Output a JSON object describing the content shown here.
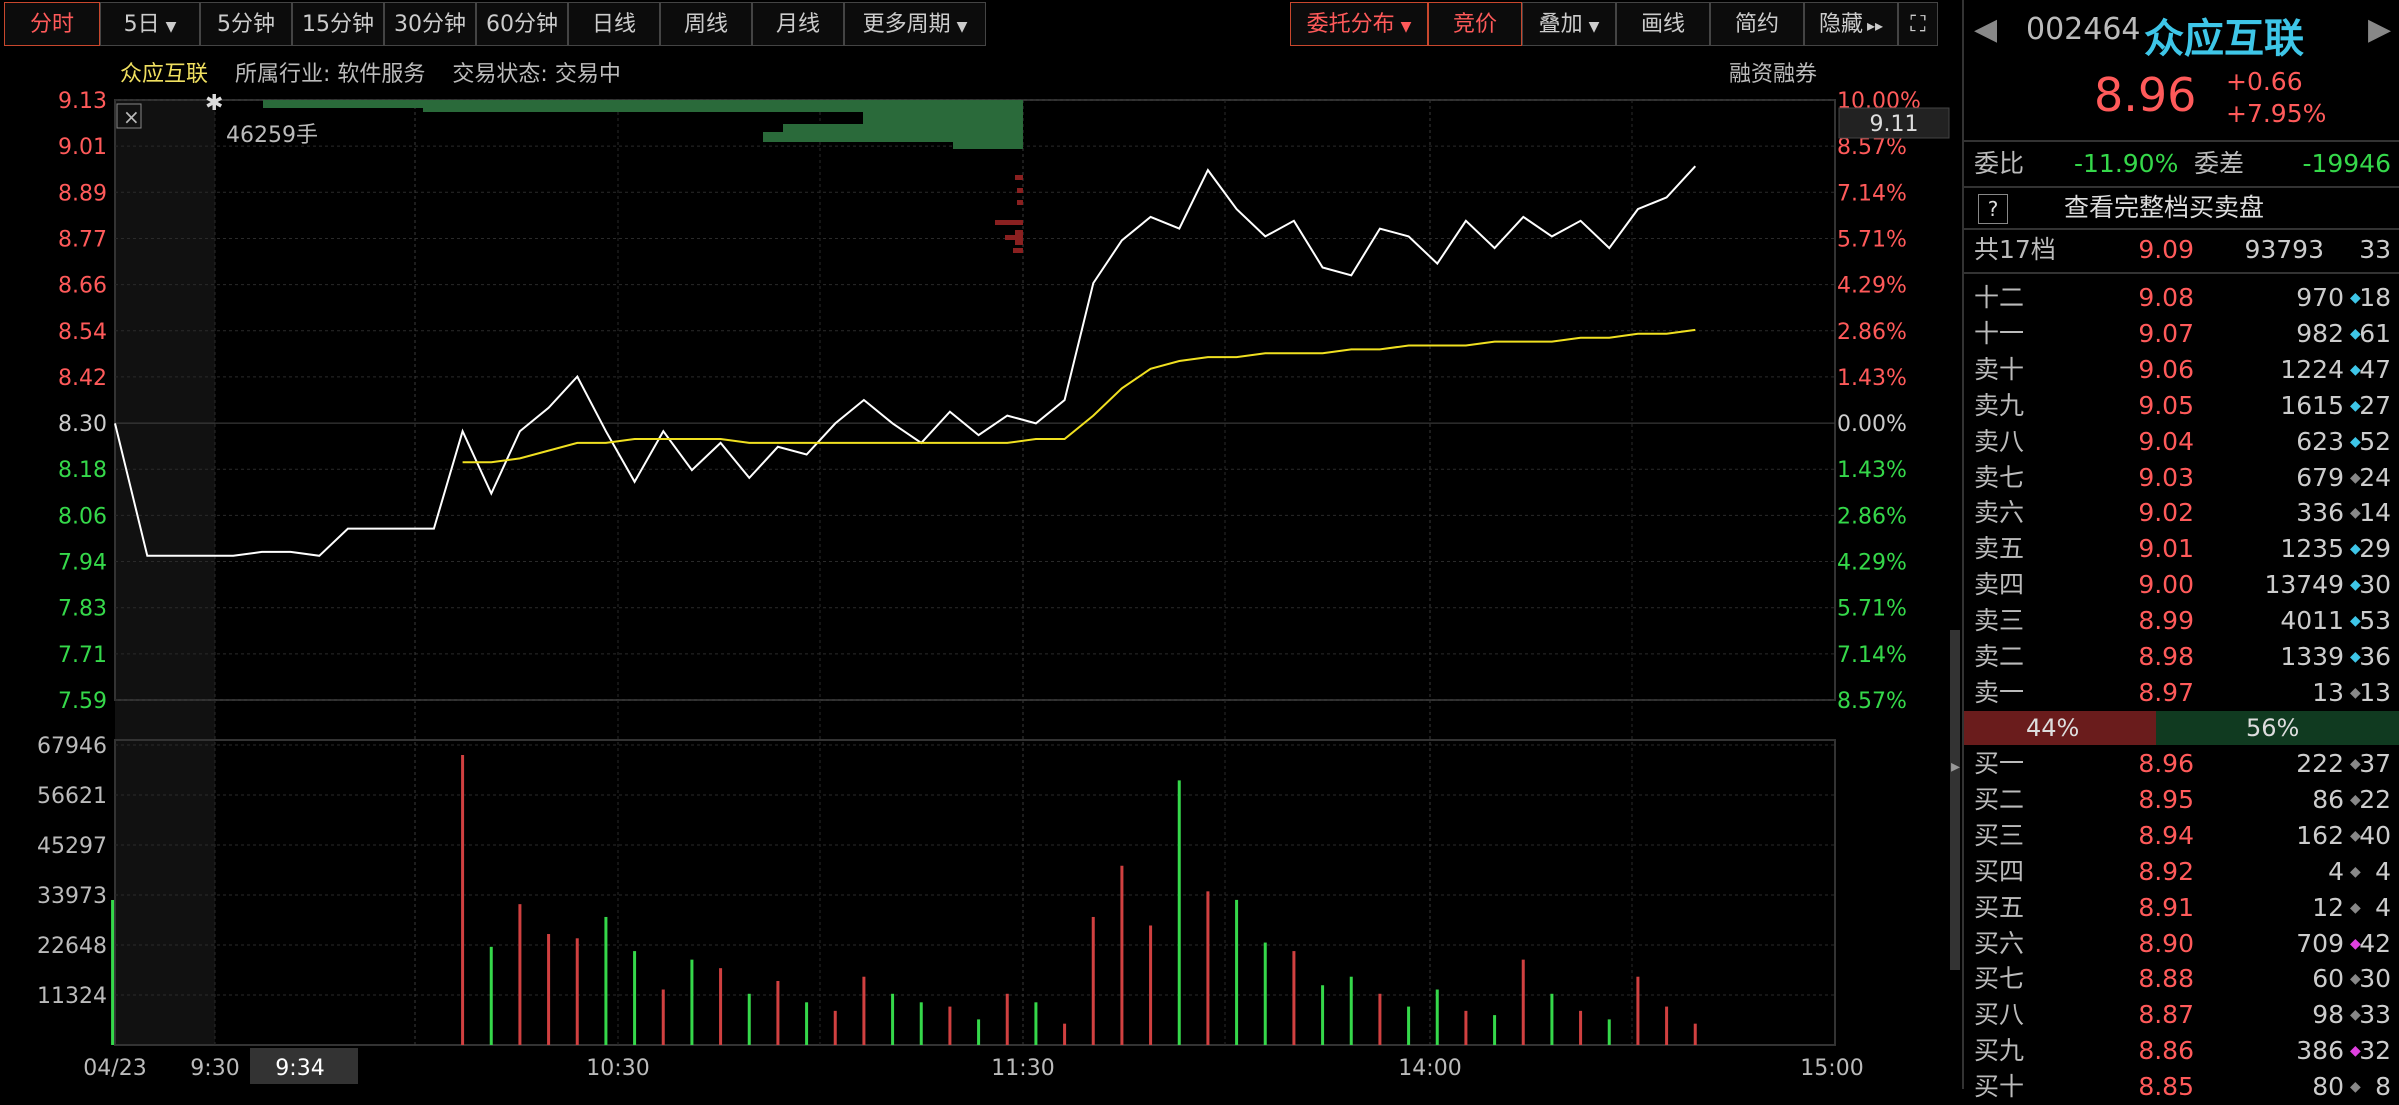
{
  "toolbar": {
    "left": [
      {
        "label": "分时",
        "active": true,
        "caret": false,
        "w": 96
      },
      {
        "label": "5日",
        "caret": true,
        "w": 100
      },
      {
        "label": "5分钟",
        "w": 92
      },
      {
        "label": "15分钟",
        "w": 92
      },
      {
        "label": "30分钟",
        "w": 92
      },
      {
        "label": "60分钟",
        "w": 92
      },
      {
        "label": "日线",
        "w": 92
      },
      {
        "label": "周线",
        "w": 92
      },
      {
        "label": "月线",
        "w": 92
      },
      {
        "label": "更多周期",
        "caret": true,
        "w": 142
      }
    ],
    "right": [
      {
        "label": "委托分布",
        "caret": true,
        "active": true,
        "w": 138
      },
      {
        "label": "竞价",
        "active": true,
        "w": 94
      },
      {
        "label": "叠加",
        "caret": true,
        "w": 94
      },
      {
        "label": "画线",
        "w": 94
      },
      {
        "label": "简约",
        "w": 94
      },
      {
        "label": "隐藏",
        "w": 94,
        "suffix": "▸▸"
      },
      {
        "label": "⛶",
        "w": 40
      }
    ]
  },
  "info": {
    "name": "众应互联",
    "industry": "所属行业: 软件服务",
    "status": "交易状态: 交易中",
    "margin": "融资融券"
  },
  "chart": {
    "volume_readout": "46259手",
    "price_box": "9.11",
    "prev_close": 8.3,
    "price_ticks": [
      "9.13",
      "9.01",
      "8.89",
      "8.77",
      "8.66",
      "8.54",
      "8.42",
      "8.30",
      "8.18",
      "8.06",
      "7.94",
      "7.83",
      "7.71",
      "7.59"
    ],
    "pct_ticks": [
      "10.00%",
      "8.57%",
      "7.14%",
      "5.71%",
      "4.29%",
      "2.86%",
      "1.43%",
      "0.00%",
      "1.43%",
      "2.86%",
      "4.29%",
      "5.71%",
      "7.14%",
      "8.57%"
    ],
    "vol_ticks": [
      "67946",
      "56621",
      "45297",
      "33973",
      "22648",
      "11324"
    ],
    "time_ticks": [
      "04/23",
      "9:30",
      "9:34",
      "10:30",
      "11:30",
      "14:00",
      "15:00"
    ],
    "colors": {
      "up": "#ff5a5a",
      "down": "#35d84a",
      "price_line": "#ffffff",
      "avg_line": "#f0e020",
      "grid": "#2a2a2a",
      "bar_red": "#d04040",
      "bar_green": "#2a6a3a"
    }
  },
  "chart_data": {
    "type": "line",
    "title": "",
    "xlabel": "",
    "ylabel": "",
    "ylim": [
      7.59,
      9.13
    ],
    "vol_ylim": [
      0,
      67946
    ],
    "series": [
      {
        "name": "",
        "values": [
          8.3,
          7.96,
          7.96,
          7.96,
          7.96,
          7.97,
          7.97,
          7.96,
          8.03,
          8.03,
          8.03,
          8.03,
          8.28,
          8.12,
          8.28,
          8.34,
          8.42,
          8.28,
          8.15,
          8.28,
          8.18,
          8.25,
          8.16,
          8.24,
          8.22,
          8.3,
          8.36,
          8.3,
          8.25,
          8.33,
          8.27,
          8.32,
          8.3,
          8.36,
          8.66,
          8.77,
          8.83,
          8.8,
          8.95,
          8.85,
          8.78,
          8.82,
          8.7,
          8.68,
          8.8,
          8.78,
          8.71,
          8.82,
          8.75,
          8.83,
          8.78,
          8.82,
          8.75,
          8.85,
          8.88,
          8.96
        ]
      },
      {
        "name": "",
        "values": [
          null,
          null,
          null,
          null,
          null,
          null,
          null,
          null,
          null,
          null,
          null,
          null,
          8.2,
          8.2,
          8.21,
          8.23,
          8.25,
          8.25,
          8.26,
          8.26,
          8.26,
          8.26,
          8.25,
          8.25,
          8.25,
          8.25,
          8.25,
          8.25,
          8.25,
          8.25,
          8.25,
          8.25,
          8.26,
          8.26,
          8.32,
          8.39,
          8.44,
          8.46,
          8.47,
          8.47,
          8.48,
          8.48,
          8.48,
          8.49,
          8.49,
          8.5,
          8.5,
          8.5,
          8.51,
          8.51,
          8.51,
          8.52,
          8.52,
          8.53,
          8.53,
          8.54
        ]
      }
    ],
    "volume": [
      33973,
      0,
      0,
      0,
      0,
      0,
      0,
      0,
      0,
      0,
      0,
      0,
      67946,
      23000,
      33000,
      26000,
      25000,
      30000,
      22000,
      13000,
      20000,
      18000,
      12000,
      15000,
      10000,
      8000,
      16000,
      12000,
      10000,
      9000,
      6000,
      12000,
      10000,
      5000,
      30000,
      42000,
      28000,
      62000,
      36000,
      34000,
      24000,
      22000,
      14000,
      16000,
      12000,
      9000,
      13000,
      8000,
      7000,
      20000,
      12000,
      8000,
      6000,
      16000,
      9000,
      5000
    ]
  },
  "panel": {
    "code": "002464",
    "name": "众应互联",
    "price": "8.96",
    "change": "+0.66",
    "change_pct": "+7.95%",
    "ratio_label": "委比",
    "ratio_value": "-11.90%",
    "diff_label": "委差",
    "diff_value": "-19946",
    "help": "?",
    "full_book": "查看完整档买卖盘",
    "total": {
      "label": "共17档",
      "price": "9.09",
      "vol": "93793",
      "cnt": "33"
    },
    "sell": [
      {
        "label": "十二",
        "price": "9.08",
        "vol": "970",
        "cnt": "18",
        "dot": "#3ec6e8"
      },
      {
        "label": "十一",
        "price": "9.07",
        "vol": "982",
        "cnt": "61",
        "dot": "#3ec6e8"
      },
      {
        "label": "卖十",
        "price": "9.06",
        "vol": "1224",
        "cnt": "47",
        "dot": "#3ec6e8"
      },
      {
        "label": "卖九",
        "price": "9.05",
        "vol": "1615",
        "cnt": "27",
        "dot": "#3ec6e8"
      },
      {
        "label": "卖八",
        "price": "9.04",
        "vol": "623",
        "cnt": "52",
        "dot": "#3ec6e8"
      },
      {
        "label": "卖七",
        "price": "9.03",
        "vol": "679",
        "cnt": "24",
        "dot": "#888888"
      },
      {
        "label": "卖六",
        "price": "9.02",
        "vol": "336",
        "cnt": "14",
        "dot": "#888888"
      },
      {
        "label": "卖五",
        "price": "9.01",
        "vol": "1235",
        "cnt": "29",
        "dot": "#3ec6e8"
      },
      {
        "label": "卖四",
        "price": "9.00",
        "vol": "13749",
        "cnt": "30",
        "dot": "#3ec6e8"
      },
      {
        "label": "卖三",
        "price": "8.99",
        "vol": "4011",
        "cnt": "53",
        "dot": "#3ec6e8"
      },
      {
        "label": "卖二",
        "price": "8.98",
        "vol": "1339",
        "cnt": "36",
        "dot": "#3ec6e8"
      },
      {
        "label": "卖一",
        "price": "8.97",
        "vol": "13",
        "cnt": "13",
        "dot": "#888888"
      }
    ],
    "buy_pct": "44%",
    "sell_pct": "56%",
    "buy": [
      {
        "label": "买一",
        "price": "8.96",
        "vol": "222",
        "cnt": "37",
        "dot": "#888888"
      },
      {
        "label": "买二",
        "price": "8.95",
        "vol": "86",
        "cnt": "22",
        "dot": "#888888"
      },
      {
        "label": "买三",
        "price": "8.94",
        "vol": "162",
        "cnt": "40",
        "dot": "#888888"
      },
      {
        "label": "买四",
        "price": "8.92",
        "vol": "4",
        "cnt": "4",
        "dot": "#888888"
      },
      {
        "label": "买五",
        "price": "8.91",
        "vol": "12",
        "cnt": "4",
        "dot": "#888888"
      },
      {
        "label": "买六",
        "price": "8.90",
        "vol": "709",
        "cnt": "42",
        "dot": "#e040e0"
      },
      {
        "label": "买七",
        "price": "8.88",
        "vol": "60",
        "cnt": "30",
        "dot": "#888888"
      },
      {
        "label": "买八",
        "price": "8.87",
        "vol": "98",
        "cnt": "33",
        "dot": "#888888"
      },
      {
        "label": "买九",
        "price": "8.86",
        "vol": "386",
        "cnt": "32",
        "dot": "#e040e0"
      },
      {
        "label": "买十",
        "price": "8.85",
        "vol": "80",
        "cnt": "8",
        "dot": "#888888"
      }
    ]
  }
}
